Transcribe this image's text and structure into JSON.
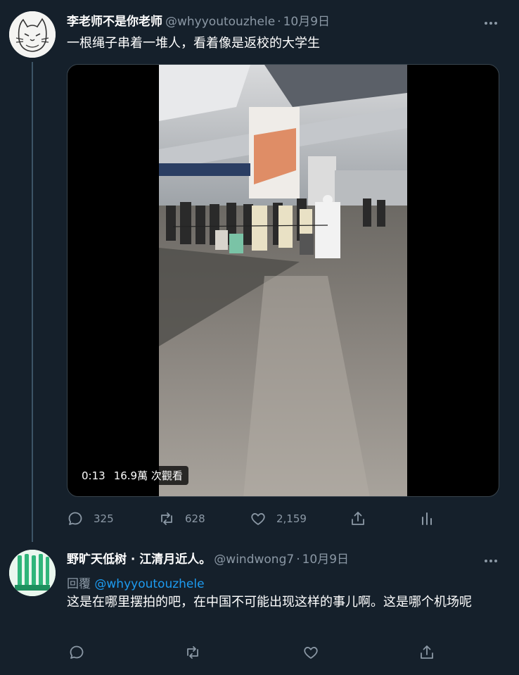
{
  "tweet1": {
    "display_name": "李老师不是你老师",
    "handle": "@whyyoutouzhele",
    "separator": "·",
    "date": "10月9日",
    "text": "一根绳子串着一堆人，看着像是返校的大学生",
    "video": {
      "duration": "0:13",
      "views": "16.9萬 次觀看"
    },
    "actions": {
      "reply_count": "325",
      "retweet_count": "628",
      "like_count": "2,159"
    },
    "icons": [
      "more-icon",
      "reply-icon",
      "retweet-icon",
      "like-icon",
      "share-icon",
      "analytics-icon"
    ]
  },
  "tweet2": {
    "display_name": "野旷天低树 · 江清月近人。",
    "handle": "@windwong7",
    "separator": "·",
    "date": "10月9日",
    "reply_prefix": "回覆",
    "reply_mention": "@whyyoutouzhele",
    "text": "这是在哪里摆拍的吧，在中国不可能出现这样的事儿啊。这是哪个机场呢",
    "icons": [
      "more-icon",
      "reply-icon",
      "retweet-icon",
      "like-icon",
      "share-icon"
    ]
  },
  "colors": {
    "background": "#15202b",
    "secondary_text": "#8b98a5",
    "link": "#1d9bf0",
    "border": "#38444d"
  }
}
